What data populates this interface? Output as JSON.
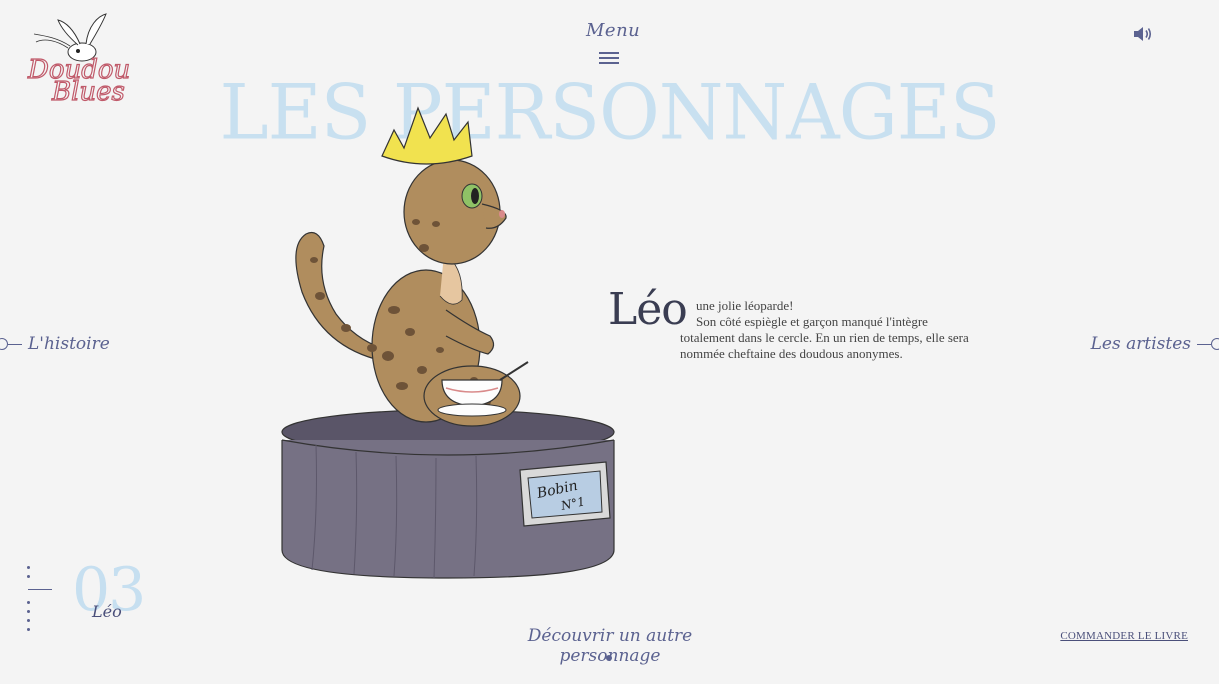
{
  "logo": {
    "line1": "Doudou",
    "line2": "Blues"
  },
  "header": {
    "menu_label": "Menu"
  },
  "title": "LES PERSONNAGES",
  "nav": {
    "left_label": "L'histoire",
    "right_label": "Les artistes"
  },
  "character": {
    "name": "Léo",
    "number": "03",
    "desc_line1": "une jolie léoparde!",
    "desc_rest": "Son côté espiègle et garçon manqué l'intègre totalement dans le cercle. En un rien de temps, elle sera nommée cheftaine des doudous anonymes.",
    "box_label_1": "Bobin",
    "box_label_2": "N°1"
  },
  "footer": {
    "discover_label": "Découvrir un autre personnage",
    "order_label": "COMMANDER LE LIVRE"
  },
  "colors": {
    "accent": "#5b6290",
    "title": "#c8e0f0",
    "leopard": "#b08d5e",
    "crown": "#f0e050",
    "box": "#757083"
  },
  "icons": {
    "sound": "speaker-icon",
    "menu": "hamburger-icon",
    "rabbit": "rabbit-icon"
  }
}
